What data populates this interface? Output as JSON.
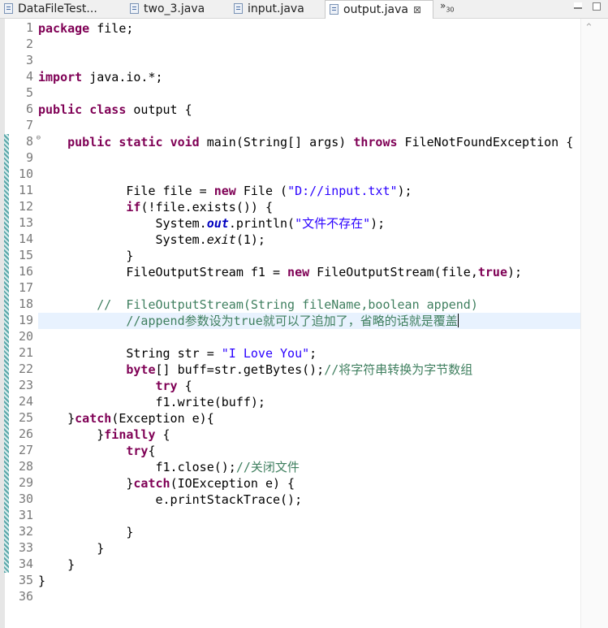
{
  "tabs": [
    {
      "label": "DataFileTest...",
      "active": false
    },
    {
      "label": "two_3.java",
      "active": false
    },
    {
      "label": "input.java",
      "active": false
    },
    {
      "label": "output.java",
      "active": true
    }
  ],
  "tab_close_glyph": "⊠",
  "overflow_label": "»",
  "overflow_count": "30",
  "scroll_up_glyph": "⌃",
  "fold_glyph": "⊖",
  "line_numbers": [
    "1",
    "2",
    "3",
    "4",
    "5",
    "6",
    "7",
    "8",
    "9",
    "10",
    "11",
    "12",
    "13",
    "14",
    "15",
    "16",
    "17",
    "18",
    "19",
    "20",
    "21",
    "22",
    "23",
    "24",
    "25",
    "26",
    "27",
    "28",
    "29",
    "30",
    "31",
    "32",
    "33",
    "34",
    "35",
    "36"
  ],
  "code_lines": [
    [
      {
        "t": "package",
        "c": "kw"
      },
      {
        "t": " file;"
      }
    ],
    [],
    [],
    [
      {
        "t": "import",
        "c": "kw"
      },
      {
        "t": " java.io.*;"
      }
    ],
    [],
    [
      {
        "t": "public",
        "c": "kw"
      },
      {
        "t": " "
      },
      {
        "t": "class",
        "c": "kw"
      },
      {
        "t": " output {"
      }
    ],
    [],
    [
      {
        "t": "    "
      },
      {
        "t": "public",
        "c": "kw"
      },
      {
        "t": " "
      },
      {
        "t": "static",
        "c": "kw"
      },
      {
        "t": " "
      },
      {
        "t": "void",
        "c": "kw"
      },
      {
        "t": " main(String[] args) "
      },
      {
        "t": "throws",
        "c": "kw"
      },
      {
        "t": " FileNotFoundException {"
      }
    ],
    [],
    [],
    [
      {
        "t": "            File file = "
      },
      {
        "t": "new",
        "c": "kw"
      },
      {
        "t": " File ("
      },
      {
        "t": "\"D://input.txt\"",
        "c": "str"
      },
      {
        "t": ");"
      }
    ],
    [
      {
        "t": "            "
      },
      {
        "t": "if",
        "c": "kw"
      },
      {
        "t": "(!file.exists()) {"
      }
    ],
    [
      {
        "t": "                System."
      },
      {
        "t": "out",
        "c": "fld"
      },
      {
        "t": ".println("
      },
      {
        "t": "\"文件不存在\"",
        "c": "str"
      },
      {
        "t": ");"
      }
    ],
    [
      {
        "t": "                System."
      },
      {
        "t": "exit",
        "c": "ital"
      },
      {
        "t": "(1);"
      }
    ],
    [
      {
        "t": "            }"
      }
    ],
    [
      {
        "t": "            FileOutputStream f1 = "
      },
      {
        "t": "new",
        "c": "kw"
      },
      {
        "t": " FileOutputStream(file,"
      },
      {
        "t": "true",
        "c": "kw"
      },
      {
        "t": ");"
      }
    ],
    [],
    [
      {
        "t": "        //  FileOutputStream(String fileName,boolean append)",
        "c": "cmt"
      }
    ],
    [
      {
        "t": "            //append参数设为true就可以了追加了，省略的话就是覆盖",
        "c": "cmt"
      }
    ],
    [],
    [
      {
        "t": "            String str = "
      },
      {
        "t": "\"I Love You\"",
        "c": "str"
      },
      {
        "t": ";"
      }
    ],
    [
      {
        "t": "            "
      },
      {
        "t": "byte",
        "c": "kw"
      },
      {
        "t": "[] buff=str.getBytes();"
      },
      {
        "t": "//将字符串转换为字节数组",
        "c": "cmt"
      }
    ],
    [
      {
        "t": "                "
      },
      {
        "t": "try",
        "c": "kw"
      },
      {
        "t": " {"
      }
    ],
    [
      {
        "t": "                f1.write(buff);"
      }
    ],
    [
      {
        "t": "    }"
      },
      {
        "t": "catch",
        "c": "kw"
      },
      {
        "t": "(Exception e){"
      }
    ],
    [
      {
        "t": "        }"
      },
      {
        "t": "finally",
        "c": "kw"
      },
      {
        "t": " {"
      }
    ],
    [
      {
        "t": "            "
      },
      {
        "t": "try",
        "c": "kw"
      },
      {
        "t": "{"
      }
    ],
    [
      {
        "t": "                f1.close();"
      },
      {
        "t": "//关闭文件",
        "c": "cmt"
      }
    ],
    [
      {
        "t": "            }"
      },
      {
        "t": "catch",
        "c": "kw"
      },
      {
        "t": "(IOException e) {"
      }
    ],
    [
      {
        "t": "                e.printStackTrace();"
      }
    ],
    [],
    [
      {
        "t": "            }"
      }
    ],
    [
      {
        "t": "        }"
      }
    ],
    [
      {
        "t": "    }"
      }
    ],
    [
      {
        "t": "}"
      }
    ],
    []
  ]
}
